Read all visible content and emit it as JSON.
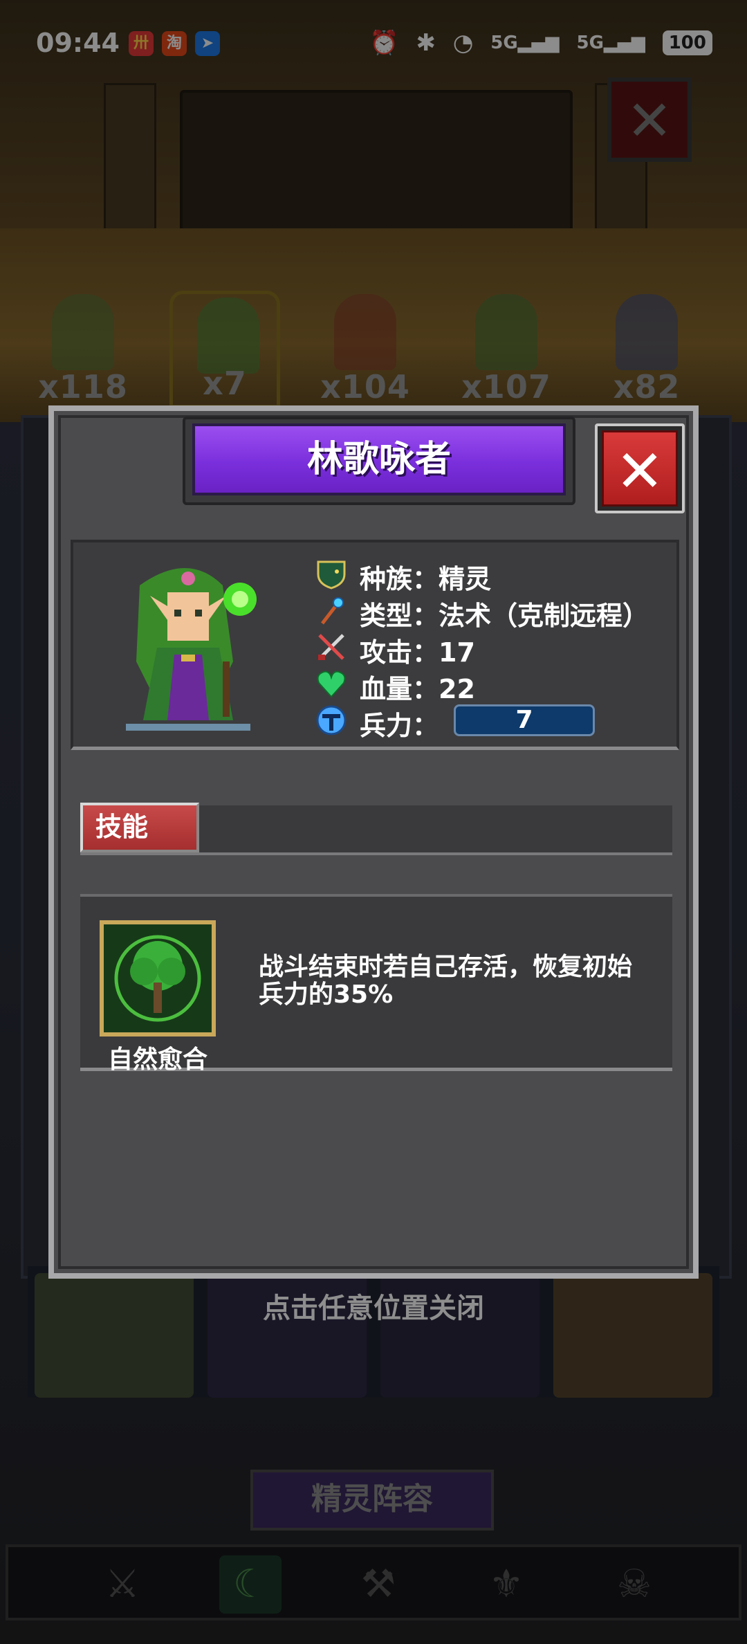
{
  "status_bar": {
    "time": "09:44",
    "battery": "100",
    "apps": [
      "app-icon-1",
      "taobao-icon",
      "direction-icon"
    ]
  },
  "background": {
    "hero_counts": [
      "x118",
      "x7",
      "x104",
      "x107",
      "x82"
    ],
    "team_button": "精灵阵容",
    "tabs": [
      "swords-icon",
      "moon-star-shield-icon",
      "axes-icon",
      "sword-emblem-icon",
      "skull-icon"
    ]
  },
  "modal": {
    "title": "林歌咏者",
    "close_label": "✕",
    "stats": {
      "race": "种族：精灵",
      "type": "类型：法术（克制远程）",
      "attack": "攻击：17",
      "hp": "血量：22",
      "troops_label": "兵力：",
      "troops_value": "7"
    },
    "skill_tab": "技能",
    "skill": {
      "name": "自然愈合",
      "description": "战斗结束时若自己存活，恢复初始兵力的35%"
    }
  },
  "hint": "点击任意位置关闭",
  "colors": {
    "title_purple": "#7a2fdc",
    "close_red": "#c42a2a",
    "skill_tab_red": "#b53636",
    "troop_blue": "#0d3a6a",
    "panel_gray": "#4b4b4d"
  }
}
